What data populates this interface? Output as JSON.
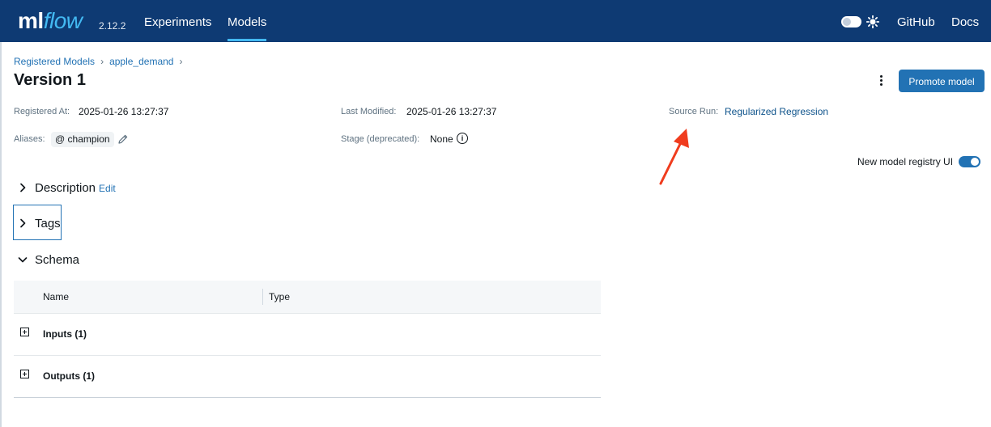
{
  "header": {
    "logo_ml": "ml",
    "logo_flow": "flow",
    "version": "2.12.2",
    "nav": {
      "experiments": "Experiments",
      "models": "Models"
    },
    "links": {
      "github": "GitHub",
      "docs": "Docs"
    }
  },
  "breadcrumb": {
    "registered_models": "Registered Models",
    "model_name": "apple_demand"
  },
  "page": {
    "title": "Version 1",
    "promote_label": "Promote model"
  },
  "meta": {
    "registered_at_label": "Registered At:",
    "registered_at_value": "2025-01-26 13:27:37",
    "last_modified_label": "Last Modified:",
    "last_modified_value": "2025-01-26 13:27:37",
    "source_run_label": "Source Run:",
    "source_run_value": "Regularized Regression",
    "aliases_label": "Aliases:",
    "alias_value": "@ champion",
    "stage_label": "Stage (deprecated):",
    "stage_value": "None"
  },
  "toggle": {
    "label": "New model registry UI",
    "on": true
  },
  "sections": {
    "description": "Description",
    "description_edit": "Edit",
    "tags": "Tags",
    "schema": "Schema"
  },
  "schema": {
    "columns": {
      "name": "Name",
      "type": "Type"
    },
    "rows": [
      {
        "label": "Inputs (1)"
      },
      {
        "label": "Outputs (1)"
      }
    ]
  },
  "colors": {
    "header_bg": "#0e3a73",
    "accent": "#2272b4",
    "annotation_arrow": "#f03c1e"
  }
}
